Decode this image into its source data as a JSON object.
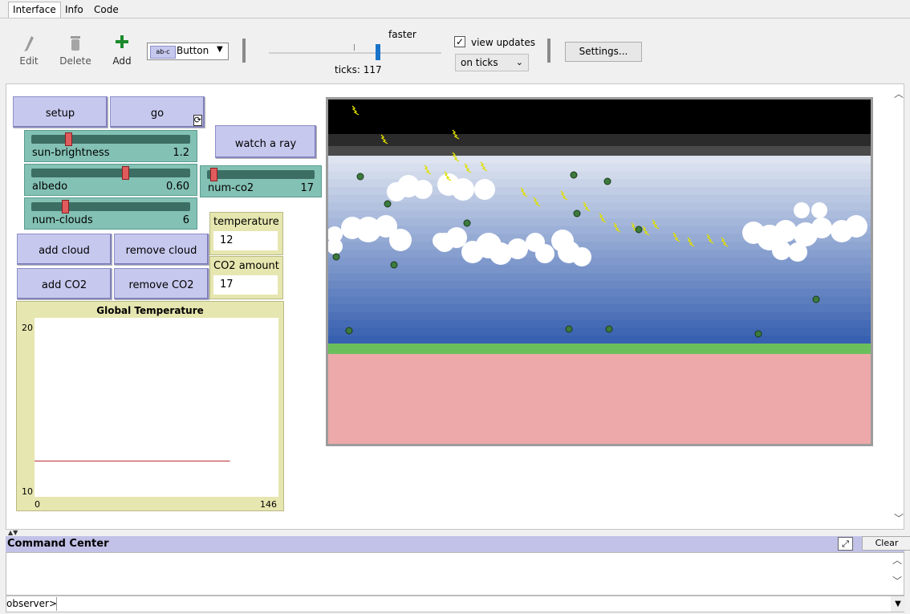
{
  "tabs": [
    {
      "label": "Interface",
      "active": true
    },
    {
      "label": "Info",
      "active": false
    },
    {
      "label": "Code",
      "active": false
    }
  ],
  "toolbar": {
    "edit_label": "Edit",
    "delete_label": "Delete",
    "add_label": "Add",
    "widget_type": "Button",
    "widget_icon_text": "ab-c",
    "speed_label": "faster",
    "speed_level": 0.62,
    "ticks_label": "ticks: 117",
    "view_updates_label": "view updates",
    "view_updates_checked": true,
    "update_mode": "on ticks",
    "settings_label": "Settings..."
  },
  "buttons": {
    "setup": "setup",
    "go": "go",
    "watch_ray": "watch a ray",
    "add_cloud": "add cloud",
    "remove_cloud": "remove cloud",
    "add_co2": "add CO2",
    "remove_co2": "remove CO2"
  },
  "sliders": {
    "sun_brightness": {
      "label": "sun-brightness",
      "value": "1.2",
      "level": 0.22
    },
    "albedo": {
      "label": "albedo",
      "value": "0.60",
      "level": 0.6
    },
    "num_co2": {
      "label": "num-co2",
      "value": "17",
      "level": 0.03
    },
    "num_clouds": {
      "label": "num-clouds",
      "value": "6",
      "level": 0.2
    }
  },
  "monitors": {
    "temperature": {
      "label": "temperature",
      "value": "12"
    },
    "co2": {
      "label": "CO2 amount",
      "value": "17"
    }
  },
  "chart_data": {
    "type": "line",
    "title": "Global Temperature",
    "xlabel": "",
    "ylabel": "",
    "xlim": [
      0,
      146
    ],
    "ylim": [
      10,
      20
    ],
    "x_ticks": [
      "0",
      "146"
    ],
    "y_ticks": [
      "20",
      "10"
    ],
    "series": [
      {
        "color": "#b52a2a",
        "x": [
          0,
          117
        ],
        "y": [
          12,
          12
        ]
      }
    ]
  },
  "colors": {
    "button": "#c7c8ee",
    "slider": "#83c1b4",
    "monitor": "#e6e6b0",
    "ground": "#eda9a9",
    "grass": "#6abf5c",
    "sunray": "#e0e000"
  },
  "command_center": {
    "title": "Command Center",
    "clear_label": "Clear",
    "prompt": "observer>",
    "input_value": ""
  }
}
